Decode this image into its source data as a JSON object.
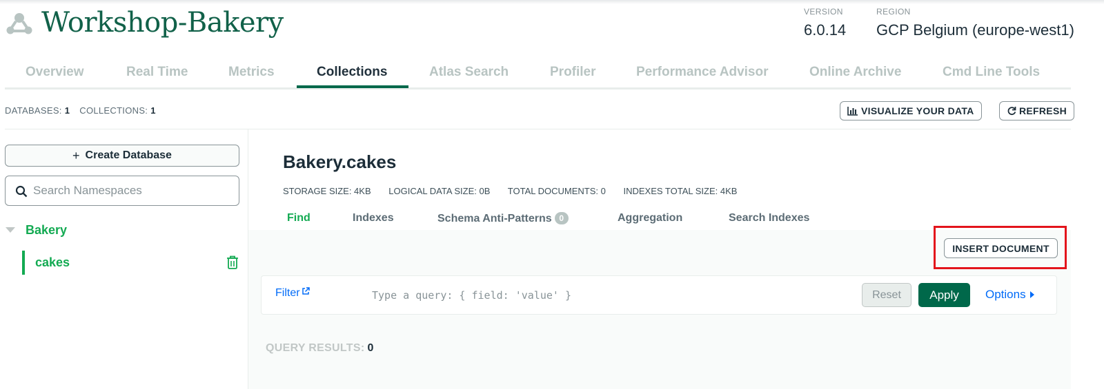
{
  "header": {
    "cluster_name": "Workshop-Bakery",
    "cluster_icon": "cluster-icon",
    "version_label": "VERSION",
    "version_value": "6.0.14",
    "region_label": "REGION",
    "region_value": "GCP Belgium (europe-west1)"
  },
  "tabs": [
    {
      "label": "Overview"
    },
    {
      "label": "Real Time"
    },
    {
      "label": "Metrics"
    },
    {
      "label": "Collections",
      "active": true
    },
    {
      "label": "Atlas Search"
    },
    {
      "label": "Profiler"
    },
    {
      "label": "Performance Advisor"
    },
    {
      "label": "Online Archive"
    },
    {
      "label": "Cmd Line Tools"
    }
  ],
  "counts": {
    "databases_label": "DATABASES:",
    "databases_value": "1",
    "collections_label": "COLLECTIONS:",
    "collections_value": "1"
  },
  "toolbar": {
    "visualize_label": "VISUALIZE YOUR DATA",
    "visualize_icon": "bar-chart-icon",
    "refresh_label": "REFRESH",
    "refresh_icon": "refresh-icon"
  },
  "sidebar": {
    "create_db_label": "Create Database",
    "search_placeholder": "Search Namespaces",
    "databases": [
      {
        "name": "Bakery",
        "expanded": true,
        "collections": [
          {
            "name": "cakes",
            "selected": true
          }
        ]
      }
    ]
  },
  "main": {
    "namespace": "Bakery.cakes",
    "stats": {
      "storage_size": "STORAGE SIZE: 4KB",
      "logical_size": "LOGICAL DATA SIZE: 0B",
      "total_documents": "TOTAL DOCUMENTS: 0",
      "indexes_size": "INDEXES TOTAL SIZE: 4KB"
    },
    "subtabs": [
      {
        "label": "Find",
        "active": true
      },
      {
        "label": "Indexes"
      },
      {
        "label": "Schema Anti-Patterns",
        "badge": "0"
      },
      {
        "label": "Aggregation"
      },
      {
        "label": "Search Indexes"
      }
    ],
    "insert_label": "INSERT DOCUMENT",
    "filter": {
      "label": "Filter",
      "placeholder": "Type a query: { field: 'value' }",
      "value": "",
      "reset_label": "Reset",
      "apply_label": "Apply",
      "options_label": "Options"
    },
    "query_results_label": "QUERY RESULTS:",
    "query_results_value": "0"
  },
  "colors": {
    "brand_green": "#00684a",
    "accent_green": "#13aa52",
    "link_blue": "#016bf8",
    "highlight_red": "#e3141b"
  }
}
